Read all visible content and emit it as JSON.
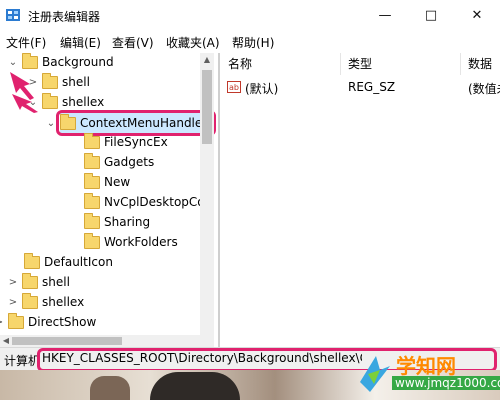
{
  "window": {
    "title": "注册表编辑器",
    "controls": [
      "—",
      "□",
      "✕"
    ]
  },
  "menu": [
    "文件(F)",
    "编辑(E)",
    "查看(V)",
    "收藏夹(A)",
    "帮助(H)"
  ],
  "tree": {
    "rows": [
      {
        "label": "Background",
        "arrow": "⌄"
      },
      {
        "label": "shell",
        "arrow": ">"
      },
      {
        "label": "shellex",
        "arrow": "⌄"
      },
      {
        "label": "ContextMenuHandle",
        "arrow": "⌄"
      },
      {
        "label": "FileSyncEx",
        "arrow": ""
      },
      {
        "label": "Gadgets",
        "arrow": ""
      },
      {
        "label": "New",
        "arrow": ""
      },
      {
        "label": "NvCplDesktopCo",
        "arrow": ""
      },
      {
        "label": "Sharing",
        "arrow": ""
      },
      {
        "label": "WorkFolders",
        "arrow": ""
      },
      {
        "label": "DefaultIcon",
        "arrow": ""
      },
      {
        "label": "shell",
        "arrow": ">"
      },
      {
        "label": "shellex",
        "arrow": ">"
      },
      {
        "label": "DirectShow",
        "arrow": ">"
      }
    ]
  },
  "list": {
    "columns": [
      "名称",
      "类型",
      "数据"
    ],
    "rows": [
      {
        "name": "(默认)",
        "type": "REG_SZ",
        "data": "(数值未"
      }
    ]
  },
  "status": {
    "label": "计算机",
    "path": "HKEY_CLASSES_ROOT\\Directory\\Background\\shellex\\Co"
  },
  "watermark": {
    "title": "学知网",
    "url": "www.jmqz1000.com"
  },
  "colors": {
    "highlight": "#e0226e",
    "selection": "#cce8ff",
    "folder": "#f7d66c"
  }
}
